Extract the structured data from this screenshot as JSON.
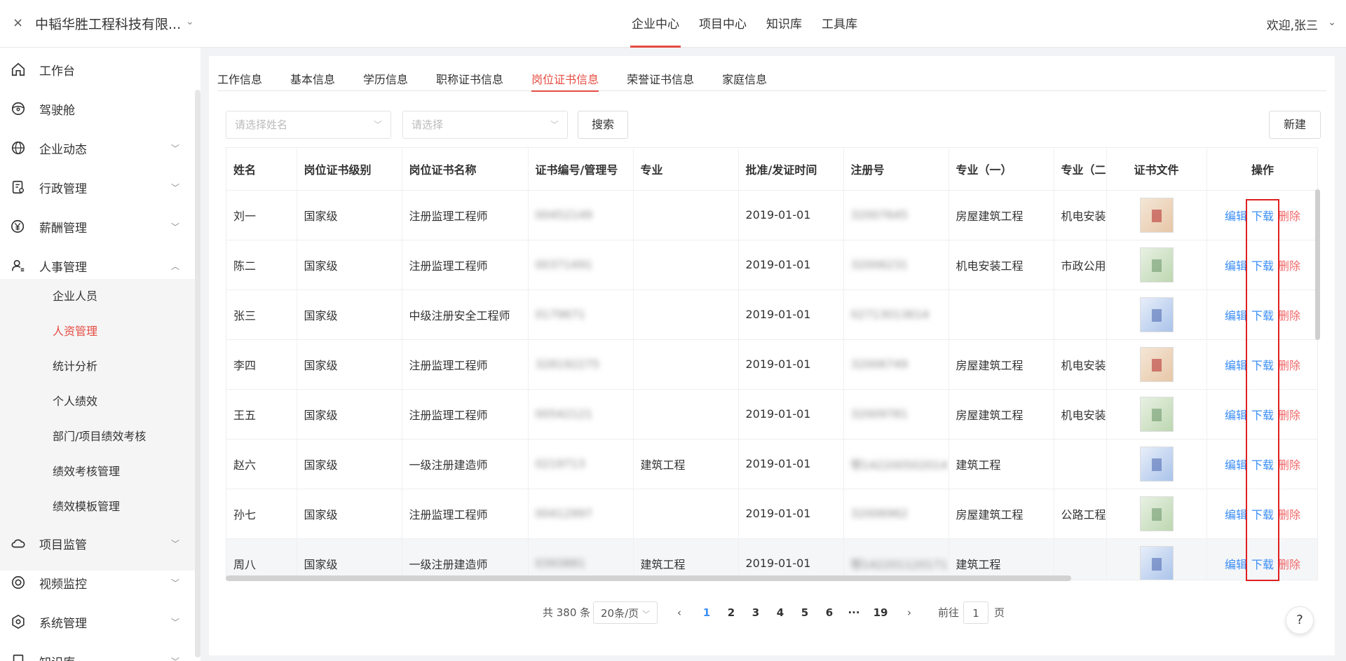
{
  "topbar": {
    "close": "×",
    "company": "中韬华胜工程科技有限...",
    "nav": [
      "企业中心",
      "项目中心",
      "知识库",
      "工具库"
    ],
    "welcome": "欢迎,张三"
  },
  "sidebar": {
    "items": [
      {
        "label": "工作台",
        "icon": "home-icon"
      },
      {
        "label": "驾驶舱",
        "icon": "steering-wheel-icon"
      },
      {
        "label": "企业动态",
        "icon": "globe-icon"
      },
      {
        "label": "行政管理",
        "icon": "document-icon"
      },
      {
        "label": "薪酬管理",
        "icon": "yen-icon"
      },
      {
        "label": "人事管理",
        "icon": "user-icon"
      },
      {
        "label": "项目监管",
        "icon": "cloud-icon"
      },
      {
        "label": "视频监控",
        "icon": "camera-icon"
      },
      {
        "label": "系统管理",
        "icon": "settings-icon"
      },
      {
        "label": "知识库",
        "icon": "book-icon"
      }
    ],
    "subitems": [
      "企业人员",
      "人资管理",
      "统计分析",
      "个人绩效",
      "部门/项目绩效考核",
      "绩效考核管理",
      "绩效模板管理"
    ]
  },
  "tabs": [
    "工作信息",
    "基本信息",
    "学历信息",
    "职称证书信息",
    "岗位证书信息",
    "荣誉证书信息",
    "家庭信息"
  ],
  "filters": {
    "name_placeholder": "请选择姓名",
    "select_placeholder": "请选择",
    "search_label": "搜索",
    "new_label": "新建"
  },
  "table": {
    "headers": [
      "姓名",
      "岗位证书级别",
      "岗位证书名称",
      "证书编号/管理号",
      "专业",
      "批准/发证时间",
      "注册号",
      "专业（一）",
      "专业（二",
      "证书文件",
      "操作"
    ],
    "rows": [
      [
        "刘一",
        "国家级",
        "注册监理工程师",
        "00452149",
        "",
        "2019-01-01",
        "32007645",
        "房屋建筑工程",
        "机电安装"
      ],
      [
        "陈二",
        "国家级",
        "注册监理工程师",
        "00371491",
        "",
        "2019-01-01",
        "32006231",
        "机电安装工程",
        "市政公用"
      ],
      [
        "张三",
        "国家级",
        "中级注册安全工程师",
        "0179671",
        "",
        "2019-01-01",
        "02713013614",
        "",
        ""
      ],
      [
        "李四",
        "国家级",
        "注册监理工程师",
        "328192275",
        "",
        "2019-01-01",
        "32006749",
        "房屋建筑工程",
        "机电安装"
      ],
      [
        "王五",
        "国家级",
        "注册监理工程师",
        "00542121",
        "",
        "2019-01-01",
        "32009781",
        "房屋建筑工程",
        "机电安装"
      ],
      [
        "赵六",
        "国家级",
        "一级注册建造师",
        "0219713",
        "建筑工程",
        "2019-01-01",
        "鄂142200502014",
        "建筑工程",
        ""
      ],
      [
        "孙七",
        "国家级",
        "注册监理工程师",
        "00412997",
        "",
        "2019-01-01",
        "32006962",
        "房屋建筑工程",
        "公路工程"
      ],
      [
        "周八",
        "国家级",
        "一级注册建造师",
        "0393881",
        "建筑工程",
        "2019-01-01",
        "鄂142201120171",
        "建筑工程",
        ""
      ]
    ],
    "thumbs": [
      "red",
      "green",
      "blue",
      "red",
      "green",
      "blue",
      "green",
      "blue"
    ],
    "ops": {
      "edit": "编辑",
      "download": "下载",
      "delete": "删除"
    }
  },
  "pagination": {
    "total": "共 380 条",
    "page_size": "20条/页",
    "prev": "‹",
    "pages": [
      "1",
      "2",
      "3",
      "4",
      "5",
      "6",
      "···",
      "19"
    ],
    "next": "›",
    "goto_prefix": "前往",
    "goto_value": "1",
    "goto_suffix": "页"
  },
  "help": "?"
}
